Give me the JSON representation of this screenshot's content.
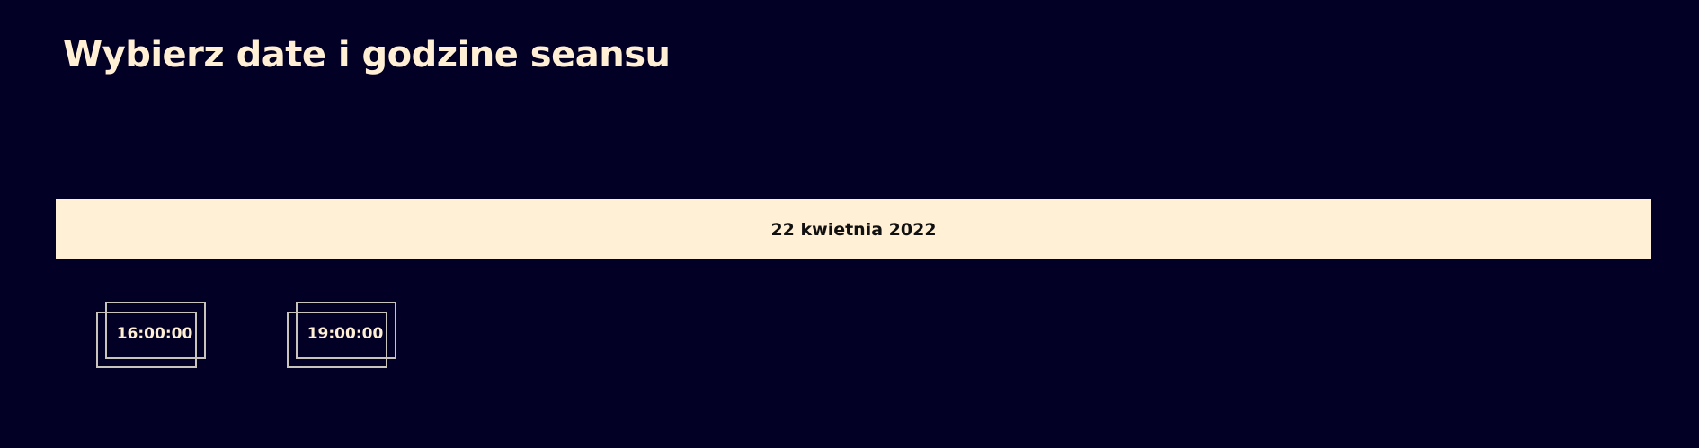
{
  "page": {
    "title": "Wybierz date i godzine seansu",
    "colors": {
      "background": "#020024",
      "accent": "#ffefd5",
      "date_bar": "#fff0d6",
      "frame_border": "#c8c3bb"
    }
  },
  "dates": [
    {
      "label": "22 kwietnia 2022",
      "times": [
        {
          "label": "16:00:00"
        },
        {
          "label": "19:00:00"
        }
      ]
    }
  ]
}
